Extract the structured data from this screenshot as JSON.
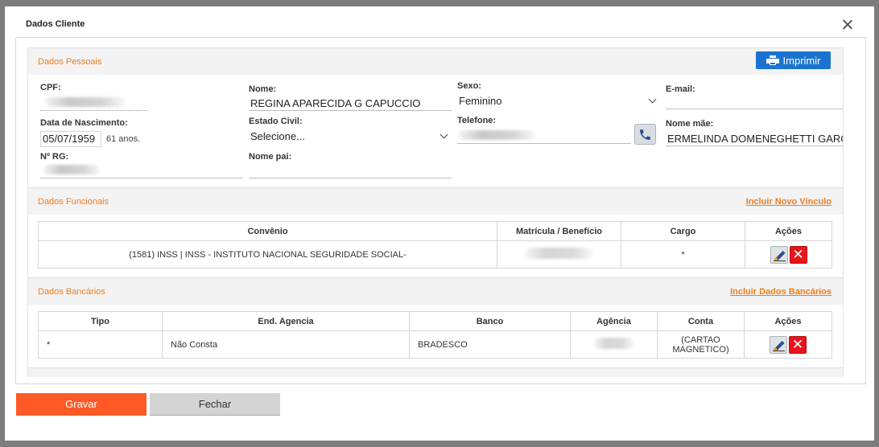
{
  "dialog": {
    "title": "Dados Cliente"
  },
  "pessoais": {
    "title": "Dados Pessoais",
    "print_label": "Imprimir",
    "cpf_label": "CPF:",
    "nome_label": "Nome:",
    "nome_value": "REGINA APARECIDA G CAPUCCIO",
    "sexo_label": "Sexo:",
    "sexo_value": "Feminino",
    "email_label": "E-mail:",
    "nascimento_label": "Data de Nascimento:",
    "nascimento_value": "05/07/1959",
    "idade": "61 anos.",
    "estado_civil_label": "Estado Civil:",
    "estado_civil_value": "Selecione...",
    "telefone_label": "Telefone:",
    "nome_mae_label": "Nome mãe:",
    "nome_mae_value": "ERMELINDA DOMENEGHETTI GARCIA",
    "rg_label": "Nº RG:",
    "nome_pai_label": "Nome pai:"
  },
  "funcionais": {
    "title": "Dados Funcionais",
    "link": "Incluir Novo Vínculo",
    "columns": [
      "Convênio",
      "Matrícula / Benefício",
      "Cargo",
      "Ações"
    ],
    "rows": [
      {
        "convenio": "(1581) INSS | INSS - INSTITUTO NACIONAL SEGURIDADE SOCIAL-",
        "cargo": "*"
      }
    ]
  },
  "bancarios": {
    "title": "Dados Bancários",
    "link": "Incluir Dados Bancários",
    "columns": [
      "Tipo",
      "End. Agencia",
      "Banco",
      "Agência",
      "Conta",
      "Ações"
    ],
    "rows": [
      {
        "tipo": "*",
        "end_agencia": "Não Consta",
        "banco": "BRADESCO",
        "conta_line1": "(CARTAO",
        "conta_line2": "MAGNETICO)"
      }
    ]
  },
  "footer": {
    "gravar": "Gravar",
    "fechar": "Fechar"
  },
  "icons": [
    "printer-icon",
    "phone-icon",
    "chevron-down-icon",
    "close-icon",
    "edit-icon",
    "delete-icon"
  ],
  "colors": {
    "accent_orange": "#f07c1c",
    "primary_button": "#ff5a26",
    "print_button": "#1a73d1",
    "delete_red": "#e8151b"
  }
}
